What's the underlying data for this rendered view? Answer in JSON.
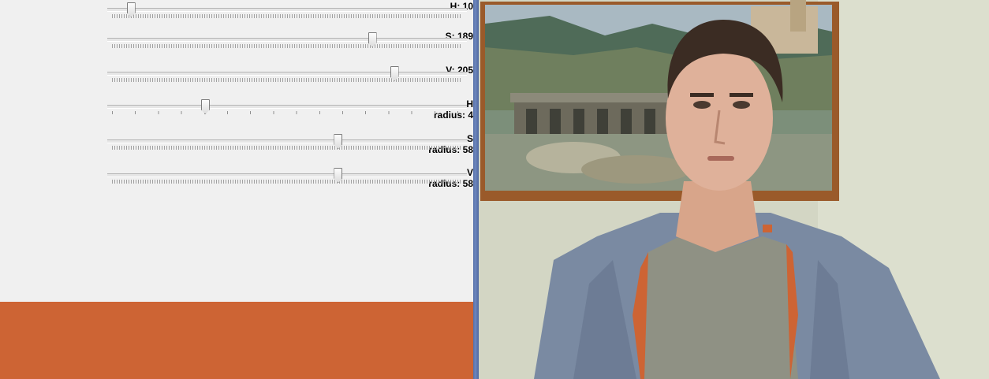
{
  "controls": {
    "h": {
      "label": "H: 10",
      "value": 10,
      "max": 180
    },
    "s": {
      "label": "S: 189",
      "value": 189,
      "max": 255
    },
    "v": {
      "label": "V: 205",
      "value": 205,
      "max": 255
    },
    "h_radius": {
      "label_top": "H",
      "label_bottom": "radius: 4",
      "value": 4,
      "max": 15
    },
    "s_radius": {
      "label_top": "S",
      "label_bottom": "radius: 58",
      "value": 58,
      "max": 90
    },
    "v_radius": {
      "label_top": "V",
      "label_bottom": "radius: 58",
      "value": 58,
      "max": 90
    }
  },
  "swatch": {
    "color": "#cd6434"
  },
  "camera": {
    "icon": "webcam-frame",
    "content": "live webcam feed with masked color region"
  }
}
